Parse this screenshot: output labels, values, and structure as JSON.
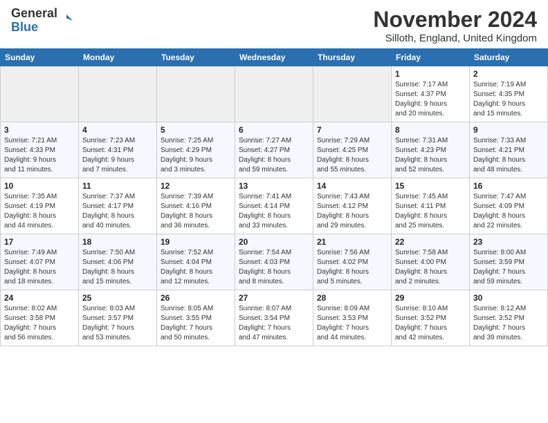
{
  "header": {
    "logo_general": "General",
    "logo_blue": "Blue",
    "month_title": "November 2024",
    "location": "Silloth, England, United Kingdom"
  },
  "days_of_week": [
    "Sunday",
    "Monday",
    "Tuesday",
    "Wednesday",
    "Thursday",
    "Friday",
    "Saturday"
  ],
  "weeks": [
    [
      {
        "day": "",
        "info": ""
      },
      {
        "day": "",
        "info": ""
      },
      {
        "day": "",
        "info": ""
      },
      {
        "day": "",
        "info": ""
      },
      {
        "day": "",
        "info": ""
      },
      {
        "day": "1",
        "info": "Sunrise: 7:17 AM\nSunset: 4:37 PM\nDaylight: 9 hours\nand 20 minutes."
      },
      {
        "day": "2",
        "info": "Sunrise: 7:19 AM\nSunset: 4:35 PM\nDaylight: 9 hours\nand 15 minutes."
      }
    ],
    [
      {
        "day": "3",
        "info": "Sunrise: 7:21 AM\nSunset: 4:33 PM\nDaylight: 9 hours\nand 11 minutes."
      },
      {
        "day": "4",
        "info": "Sunrise: 7:23 AM\nSunset: 4:31 PM\nDaylight: 9 hours\nand 7 minutes."
      },
      {
        "day": "5",
        "info": "Sunrise: 7:25 AM\nSunset: 4:29 PM\nDaylight: 9 hours\nand 3 minutes."
      },
      {
        "day": "6",
        "info": "Sunrise: 7:27 AM\nSunset: 4:27 PM\nDaylight: 8 hours\nand 59 minutes."
      },
      {
        "day": "7",
        "info": "Sunrise: 7:29 AM\nSunset: 4:25 PM\nDaylight: 8 hours\nand 55 minutes."
      },
      {
        "day": "8",
        "info": "Sunrise: 7:31 AM\nSunset: 4:23 PM\nDaylight: 8 hours\nand 52 minutes."
      },
      {
        "day": "9",
        "info": "Sunrise: 7:33 AM\nSunset: 4:21 PM\nDaylight: 8 hours\nand 48 minutes."
      }
    ],
    [
      {
        "day": "10",
        "info": "Sunrise: 7:35 AM\nSunset: 4:19 PM\nDaylight: 8 hours\nand 44 minutes."
      },
      {
        "day": "11",
        "info": "Sunrise: 7:37 AM\nSunset: 4:17 PM\nDaylight: 8 hours\nand 40 minutes."
      },
      {
        "day": "12",
        "info": "Sunrise: 7:39 AM\nSunset: 4:16 PM\nDaylight: 8 hours\nand 36 minutes."
      },
      {
        "day": "13",
        "info": "Sunrise: 7:41 AM\nSunset: 4:14 PM\nDaylight: 8 hours\nand 33 minutes."
      },
      {
        "day": "14",
        "info": "Sunrise: 7:43 AM\nSunset: 4:12 PM\nDaylight: 8 hours\nand 29 minutes."
      },
      {
        "day": "15",
        "info": "Sunrise: 7:45 AM\nSunset: 4:11 PM\nDaylight: 8 hours\nand 25 minutes."
      },
      {
        "day": "16",
        "info": "Sunrise: 7:47 AM\nSunset: 4:09 PM\nDaylight: 8 hours\nand 22 minutes."
      }
    ],
    [
      {
        "day": "17",
        "info": "Sunrise: 7:49 AM\nSunset: 4:07 PM\nDaylight: 8 hours\nand 18 minutes."
      },
      {
        "day": "18",
        "info": "Sunrise: 7:50 AM\nSunset: 4:06 PM\nDaylight: 8 hours\nand 15 minutes."
      },
      {
        "day": "19",
        "info": "Sunrise: 7:52 AM\nSunset: 4:04 PM\nDaylight: 8 hours\nand 12 minutes."
      },
      {
        "day": "20",
        "info": "Sunrise: 7:54 AM\nSunset: 4:03 PM\nDaylight: 8 hours\nand 8 minutes."
      },
      {
        "day": "21",
        "info": "Sunrise: 7:56 AM\nSunset: 4:02 PM\nDaylight: 8 hours\nand 5 minutes."
      },
      {
        "day": "22",
        "info": "Sunrise: 7:58 AM\nSunset: 4:00 PM\nDaylight: 8 hours\nand 2 minutes."
      },
      {
        "day": "23",
        "info": "Sunrise: 8:00 AM\nSunset: 3:59 PM\nDaylight: 7 hours\nand 59 minutes."
      }
    ],
    [
      {
        "day": "24",
        "info": "Sunrise: 8:02 AM\nSunset: 3:58 PM\nDaylight: 7 hours\nand 56 minutes."
      },
      {
        "day": "25",
        "info": "Sunrise: 8:03 AM\nSunset: 3:57 PM\nDaylight: 7 hours\nand 53 minutes."
      },
      {
        "day": "26",
        "info": "Sunrise: 8:05 AM\nSunset: 3:55 PM\nDaylight: 7 hours\nand 50 minutes."
      },
      {
        "day": "27",
        "info": "Sunrise: 8:07 AM\nSunset: 3:54 PM\nDaylight: 7 hours\nand 47 minutes."
      },
      {
        "day": "28",
        "info": "Sunrise: 8:09 AM\nSunset: 3:53 PM\nDaylight: 7 hours\nand 44 minutes."
      },
      {
        "day": "29",
        "info": "Sunrise: 8:10 AM\nSunset: 3:52 PM\nDaylight: 7 hours\nand 42 minutes."
      },
      {
        "day": "30",
        "info": "Sunrise: 8:12 AM\nSunset: 3:52 PM\nDaylight: 7 hours\nand 39 minutes."
      }
    ]
  ]
}
